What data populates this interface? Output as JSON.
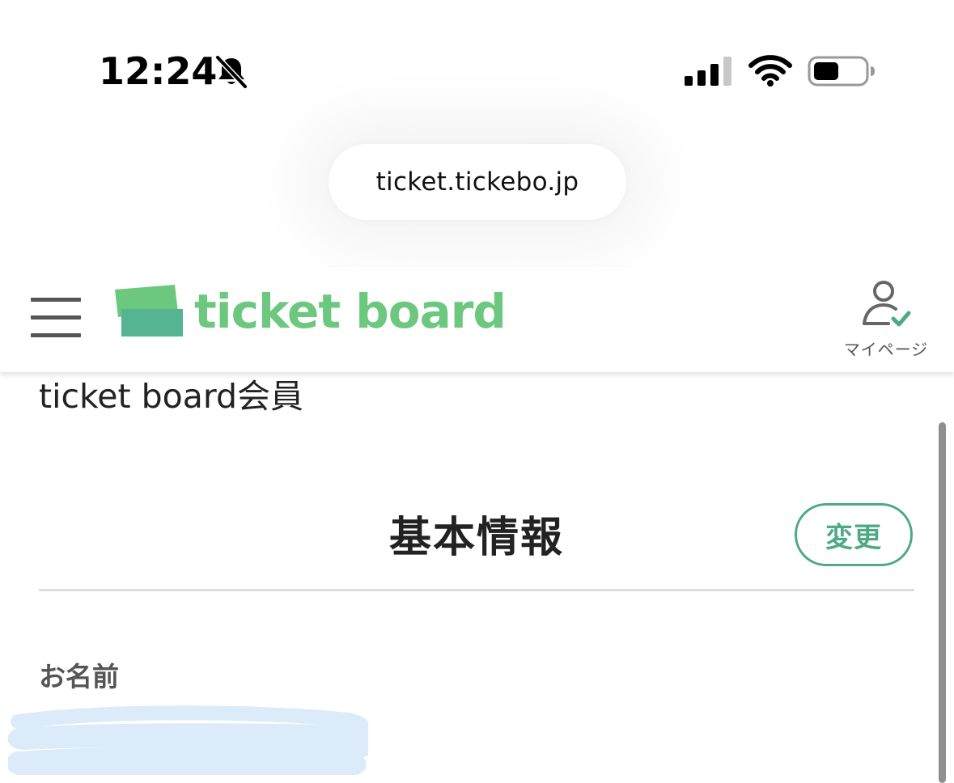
{
  "status_bar": {
    "time": "12:24",
    "icons": [
      "bell-slash-icon",
      "cellular-signal-icon",
      "wifi-icon",
      "battery-icon"
    ]
  },
  "browser": {
    "url": "ticket.tickebo.jp"
  },
  "header": {
    "logo_text": "ticket board",
    "mypage_label": "マイページ",
    "brand_color": "#6cc77f",
    "icons": [
      "hamburger-menu-icon",
      "user-check-icon"
    ]
  },
  "content": {
    "membership_title": "ticket board会員",
    "section_title": "基本情報",
    "change_button": "変更",
    "accent_color": "#4daa84",
    "fields": [
      {
        "label": "お名前",
        "value_redacted": true
      }
    ]
  }
}
